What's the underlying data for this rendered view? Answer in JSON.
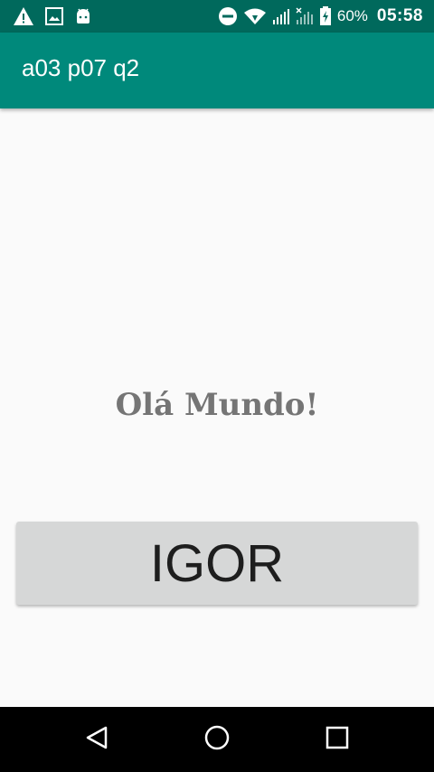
{
  "status_bar": {
    "battery_percent": "60%",
    "time": "05:58",
    "icons_left": [
      "warning-icon",
      "image-icon",
      "android-icon"
    ],
    "icons_right": [
      "do-not-disturb-icon",
      "wifi-icon",
      "signal-icon",
      "no-signal-icon",
      "battery-charging-icon"
    ]
  },
  "app_bar": {
    "title": "a03 p07 q2",
    "color": "#00897b"
  },
  "main": {
    "greeting": "Olá Mundo!",
    "button_label": "IGOR"
  },
  "nav_bar": {
    "icons": [
      "back-icon",
      "home-icon",
      "recents-icon"
    ]
  },
  "colors": {
    "status_bar": "#00695c",
    "app_bar": "#00897b",
    "background": "#fafafa",
    "button": "#d6d7d7",
    "greeting_text": "#757575"
  }
}
